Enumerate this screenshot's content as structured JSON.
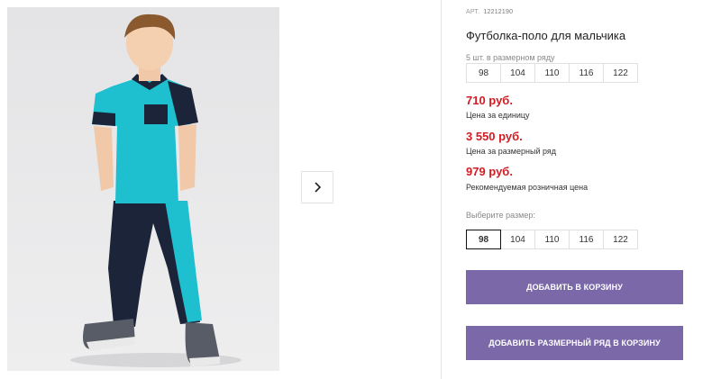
{
  "product": {
    "article_label": "АРТ.",
    "article_number": "12212190",
    "title": "Футболка-поло для мальчика",
    "pack_label": "5 шт. в размерном ряду",
    "pack_sizes": [
      "98",
      "104",
      "110",
      "116",
      "122"
    ],
    "prices": [
      {
        "value": "710 руб.",
        "label": "Цена за единицу"
      },
      {
        "value": "3 550 руб.",
        "label": "Цена за размерный ряд"
      },
      {
        "value": "979 руб.",
        "label": "Рекомендуемая розничная цена"
      }
    ],
    "choose_size_label": "Выберите размер:",
    "size_options": [
      "98",
      "104",
      "110",
      "116",
      "122"
    ],
    "selected_size": "98",
    "add_to_cart_label": "ДОБАВИТЬ В КОРЗИНУ",
    "add_pack_to_cart_label": "ДОБАВИТЬ РАЗМЕРНЫЙ РЯД В КОРЗИНУ"
  },
  "gallery": {
    "next_icon": "chevron-right-icon"
  },
  "colors": {
    "accent": "#7a68a8",
    "price": "#d21b22",
    "polo": "#1ebfcf",
    "pants": "#1b2438"
  }
}
